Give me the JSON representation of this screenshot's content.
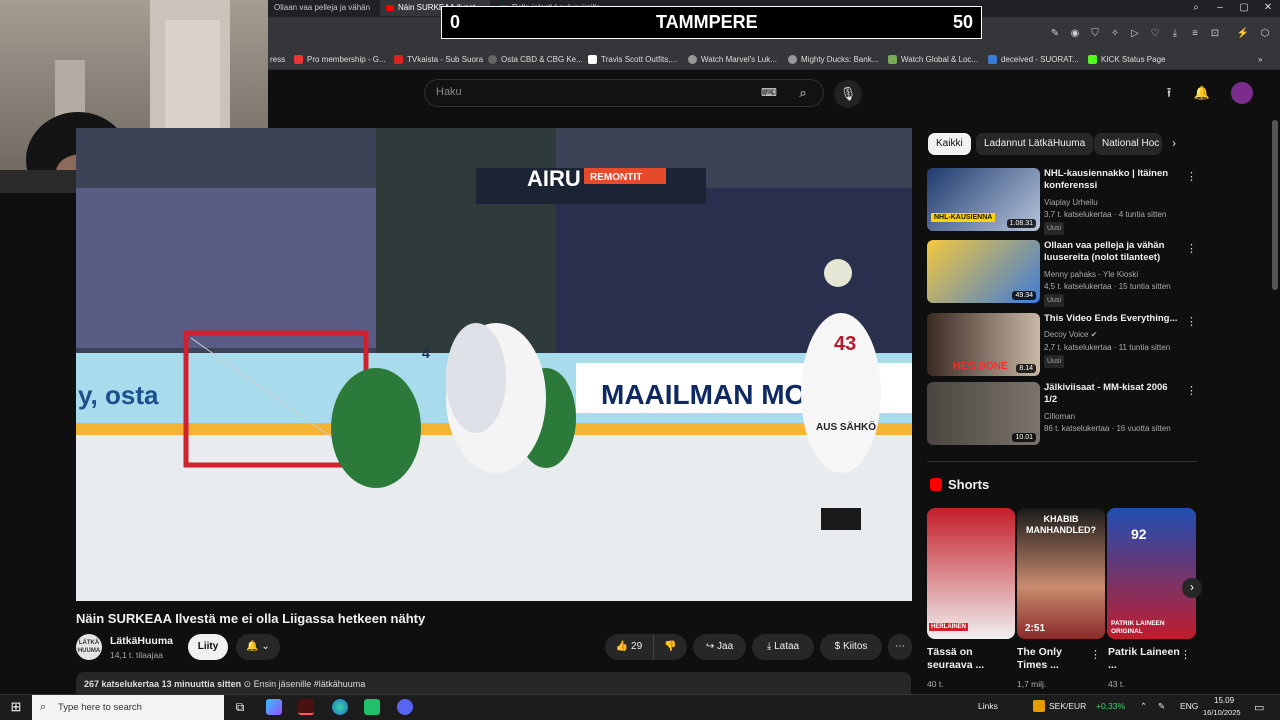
{
  "browser": {
    "tabs": [
      {
        "label": "Ollaan vaa pelleja ja vähän",
        "active": false
      },
      {
        "label": "Näin SURKEAA Ilvest",
        "active": true
      },
      {
        "label": "Pelle jalasti Laulusvirsille",
        "active": false
      }
    ],
    "bookmarks": [
      "ress",
      "Pro membership - G...",
      "TVkaista - Sub Suora",
      "Osta CBD & CBG Ke...",
      "Travis Scott Outfits,...",
      "Watch Marvel's Luk...",
      "Mighty Ducks: Bank...",
      "Watch Global & Loc...",
      "deceived - SUORAT...",
      "KICK Status Page"
    ]
  },
  "scoreboard": {
    "left_score": "0",
    "team": "TAMMPERE",
    "right_score": "50"
  },
  "youtube": {
    "search_placeholder": "Haku",
    "video": {
      "title": "Näin SURKEAA Ilvestä me ei olla Liigassa hetkeen nähty",
      "rink_ads": [
        "AIRU",
        "REMONTIT",
        "y, osta",
        "MAAILMAN MONIPU"
      ],
      "player_numbers": [
        "43",
        "4"
      ],
      "jersey_text": "AUS SÄHKÖ"
    },
    "channel": {
      "name": "LätkäHuuma",
      "subscribers": "14,1 t. tilaajaa",
      "avatar_text": "LÄTKÄ HUUMA",
      "join_label": "Liity"
    },
    "actions": {
      "likes": "29",
      "share": "Jaa",
      "download": "Lataa",
      "thanks": "Kiitos"
    },
    "description": {
      "views": "267 katselukertaa",
      "time": "13 minuuttia sitten",
      "members_first": "Ensin jäsenille",
      "hashtag": "#lätkähuuma"
    },
    "chips": [
      "Kaikki",
      "Ladannut LätkäHuuma",
      "National Hoc"
    ],
    "recommendations": [
      {
        "title": "NHL-kausiennakko | Itäinen konferenssi",
        "channel": "Viaplay Urheilu",
        "meta": "3,7 t. katselukertaa · 4 tuntia sitten",
        "duration": "1.08.31",
        "new": "Uusi",
        "thumb_text": "NHL-KAUSIENNA"
      },
      {
        "title": "Ollaan vaa pelleja ja vähän luusereita (nolot tilanteet)",
        "channel": "Menny pahaks - Yle Kioski",
        "meta": "4,5 t. katselukertaa · 15 tuntia sitten",
        "duration": "49.34",
        "new": "Uusi",
        "thumb_text": ""
      },
      {
        "title": "This Video Ends Everything...",
        "channel": "Decoy Voice",
        "meta": "2,7 t. katselukertaa · 11 tuntia sitten",
        "duration": "8.14",
        "new": "Uusi",
        "thumb_text": "HE'S DONE"
      },
      {
        "title": "Jälkiviisaat - MM-kisat 2006 1/2",
        "channel": "Cilloman",
        "meta": "86 t. katselukertaa · 16 vuotta sitten",
        "duration": "10.01",
        "new": "",
        "thumb_text": ""
      }
    ],
    "shorts_heading": "Shorts",
    "shorts": [
      {
        "title": "Tässä on seuraava ...",
        "views": "40 t.",
        "overlay": "HERLAINEN",
        "timer": ""
      },
      {
        "title": "The Only Times ...",
        "views": "1,7 milj.",
        "overlay": "KHABIB MANHANDLED?",
        "timer": "2:51"
      },
      {
        "title": "Patrik Laineen ...",
        "views": "43 t.",
        "overlay": "PATRIK LAINEEN ORIGINAL",
        "timer": "",
        "jersey": "92"
      }
    ]
  },
  "taskbar": {
    "search_placeholder": "Type here to search",
    "links": "Links",
    "ticker": "SEK/EUR",
    "ticker_change": "+0,33%",
    "language": "ENG",
    "time": "15.09",
    "date": "16/10/2025"
  },
  "colors": {
    "youtube_bg": "#0f0f0f",
    "chip_bg": "#272727",
    "accent_red": "#ff0000",
    "ticker_green": "#3fd16b"
  }
}
